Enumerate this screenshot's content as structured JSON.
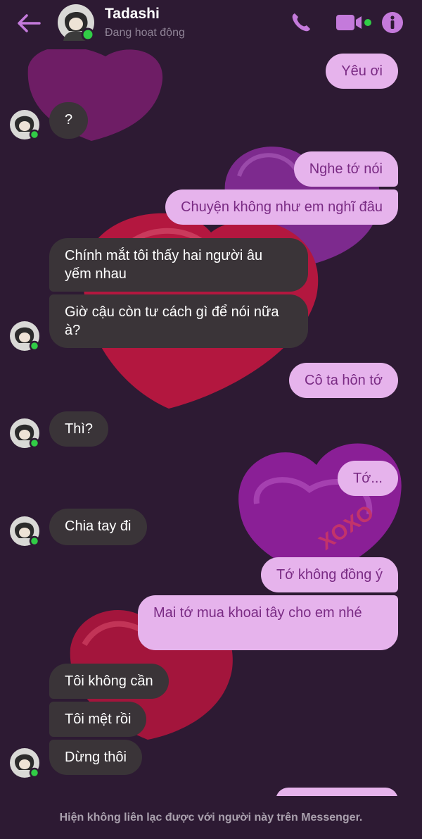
{
  "header": {
    "contact_name": "Tadashi",
    "contact_status": "Đang hoạt động",
    "icons": [
      "back-arrow-icon",
      "phone-icon",
      "video-camera-icon",
      "info-icon"
    ],
    "accent_color": "#c47adb",
    "online_color": "#31cc46"
  },
  "messages": [
    {
      "dir": "out",
      "text": "Yêu ơi"
    },
    {
      "dir": "in",
      "text": "?"
    },
    {
      "dir": "out",
      "text": "Nghe tớ nói"
    },
    {
      "dir": "out",
      "text": "Chuyện không như em nghĩ đâu"
    },
    {
      "dir": "in",
      "text": "Chính mắt tôi thấy hai người âu yếm nhau"
    },
    {
      "dir": "in",
      "text": "Giờ cậu còn tư cách gì để nói nữa à?"
    },
    {
      "dir": "out",
      "text": "Cô ta hôn tớ"
    },
    {
      "dir": "in",
      "text": "Thì?"
    },
    {
      "dir": "out",
      "text": "Tớ..."
    },
    {
      "dir": "in",
      "text": "Chia tay đi"
    },
    {
      "dir": "out",
      "text": "Tớ không đồng ý"
    },
    {
      "dir": "out",
      "text": "Mai tớ mua khoai tây cho em nhé"
    },
    {
      "dir": "in",
      "text": "Tôi không cần"
    },
    {
      "dir": "in",
      "text": "Tôi mệt rồi"
    },
    {
      "dir": "in",
      "text": "Dừng thôi"
    }
  ],
  "background_text": "XOXO",
  "footer": {
    "notice": "Hiện không liên lạc được với người này trên Messenger."
  }
}
